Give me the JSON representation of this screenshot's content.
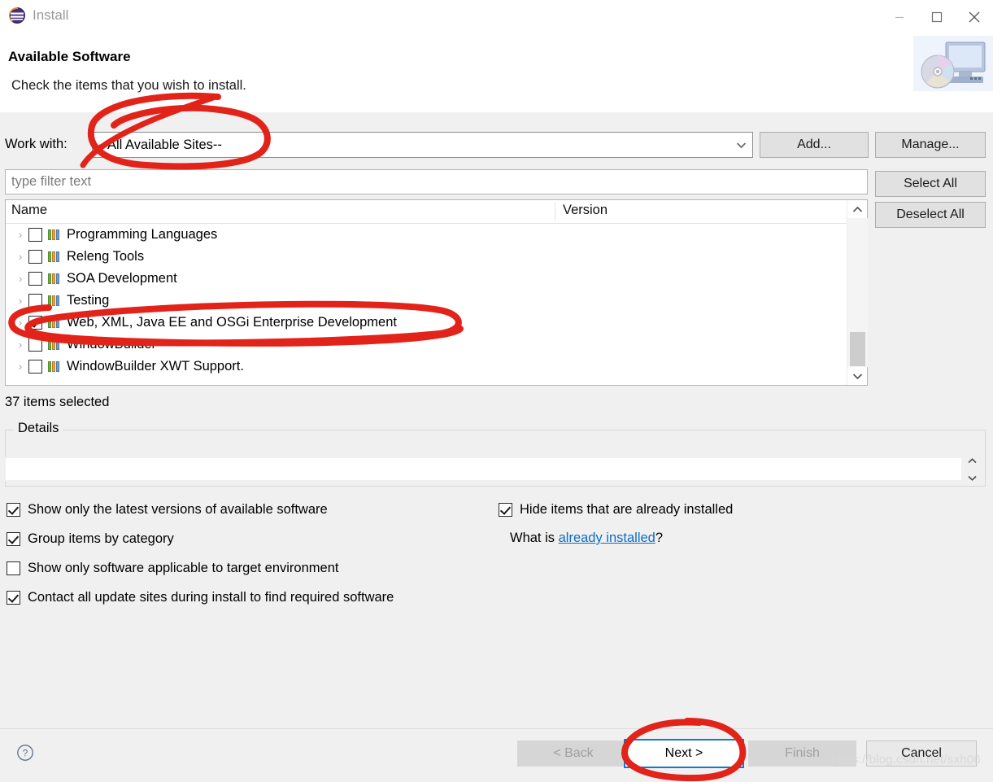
{
  "window": {
    "title": "Install",
    "app_icon": "eclipse-icon",
    "controls": {
      "minimize": "minimize-icon",
      "maximize": "maximize-icon",
      "close": "close-icon"
    }
  },
  "header": {
    "title": "Available Software",
    "subtitle": "Check the items that you wish to install.",
    "banner_icon": "install-cd-monitor-icon"
  },
  "work_with": {
    "label": "Work with:",
    "value": "--All Available Sites--",
    "dropdown_icon": "chevron-down-icon",
    "add_button": "Add...",
    "manage_button": "Manage..."
  },
  "filter": {
    "placeholder": "type filter text",
    "value": ""
  },
  "side_buttons": {
    "select_all": "Select All",
    "deselect_all": "Deselect All"
  },
  "tree": {
    "columns": [
      "Name",
      "Version"
    ],
    "rows": [
      {
        "label": "Programming Languages",
        "checked": false,
        "expandable": true,
        "icon": "category-icon"
      },
      {
        "label": "Releng Tools",
        "checked": false,
        "expandable": true,
        "icon": "category-icon"
      },
      {
        "label": "SOA Development",
        "checked": false,
        "expandable": true,
        "icon": "category-icon"
      },
      {
        "label": "Testing",
        "checked": false,
        "expandable": true,
        "icon": "category-icon"
      },
      {
        "label": "Web, XML, Java EE and OSGi Enterprise Development",
        "checked": true,
        "expandable": true,
        "icon": "category-icon"
      },
      {
        "label": "WindowBuilder",
        "checked": false,
        "expandable": true,
        "icon": "category-icon"
      },
      {
        "label": "WindowBuilder XWT Support.",
        "checked": false,
        "expandable": true,
        "icon": "category-icon"
      }
    ],
    "scrollbar": {
      "up_icon": "chevron-up-icon",
      "down_icon": "chevron-down-icon",
      "thumb_position": "near-bottom"
    }
  },
  "status": {
    "selection_count": "37 items selected"
  },
  "details": {
    "legend": "Details",
    "content": "",
    "spinner_icons": [
      "chevron-up-icon",
      "chevron-down-icon"
    ]
  },
  "options": {
    "show_latest": {
      "label": "Show only the latest versions of available software",
      "checked": true
    },
    "group_by_category": {
      "label": "Group items by category",
      "checked": true
    },
    "target_environment": {
      "label": "Show only software applicable to target environment",
      "checked": false
    },
    "contact_sites": {
      "label": "Contact all update sites during install to find required software",
      "checked": true
    },
    "hide_installed": {
      "label": "Hide items that are already installed",
      "checked": true
    },
    "what_is_prefix": "What is ",
    "what_is_link": "already installed",
    "what_is_suffix": "?"
  },
  "footer": {
    "help_icon": "help-question-icon",
    "back": "< Back",
    "next": "Next >",
    "finish": "Finish",
    "cancel": "Cancel"
  },
  "watermark": "https://blog.csdn.net/sxh06",
  "annotations": {
    "color": "#e2231a",
    "marks": [
      "circle-around-work-with-value",
      "ellipse-around-web-xml-java-ee-row",
      "circle-around-next-button"
    ]
  },
  "colors": {
    "accent_blue": "#1279cf",
    "link_blue": "#0b6fc4",
    "annotation_red": "#e2231a",
    "dialog_bg": "#f0f0f0",
    "field_bg": "#ffffff"
  }
}
